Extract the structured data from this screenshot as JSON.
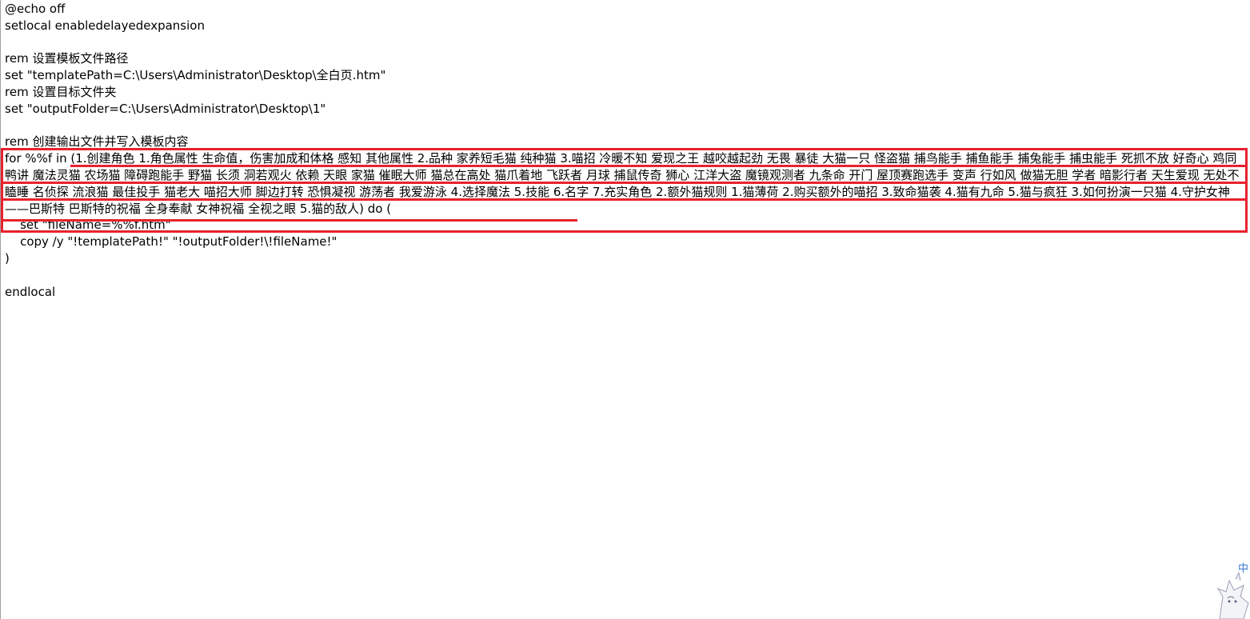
{
  "editor": {
    "lines": [
      "@echo off",
      "setlocal enabledelayedexpansion",
      "",
      "rem 设置模板文件路径",
      "set \"templatePath=C:\\Users\\Administrator\\Desktop\\全白页.htm\"",
      "rem 设置目标文件夹",
      "set \"outputFolder=C:\\Users\\Administrator\\Desktop\\1\"",
      "",
      "rem 创建输出文件并写入模板内容"
    ],
    "for_line": "for %%f in (1.创建角色 1.角色属性 生命值，伤害加成和体格 感知 其他属性 2.品种 家养短毛猫 纯种猫 3.喵招 冷暖不知 爱现之王 越咬越起劲 无畏 暴徒 大猫一只 怪盗猫 捕鸟能手 捕鱼能手 捕兔能手 捕虫能手 死抓不放 好奇心 鸡同鸭讲 魔法灵猫 农场猫 障碍跑能手 野猫 长须 洞若观火 依赖 天眼 家猫 催眠大师 猫总在高处 猫爪着地 飞跃者 月球 捕鼠传奇 狮心 江洋大盗 魔镜观测者 九条命 开门 屋顶赛跑选手 变声 行如风 做猫无胆 学者 暗影行者 天生爱现 无处不瞌睡 名侦探 流浪猫 最佳投手 猫老大 喵招大师 脚边打转 恐惧凝视 游荡者 我爱游泳 4.选择魔法 5.技能 6.名字 7.充实角色 2.额外猫规则 1.猫薄荷 2.购买额外的喵招 3.致命猫袭 4.猫有九命 5.猫与疯狂 3.如何扮演一只猫 4.守护女神——巴斯特 巴斯特的祝福 全身奉献 女神祝福 全视之眼 5.猫的敌人) do (",
    "after_lines": [
      "    set \"fileName=%%f.htm\"",
      "    copy /y \"!templatePath!\" \"!outputFolder!\\!fileName!\"",
      ")",
      "",
      "endlocal"
    ]
  },
  "ime": {
    "label": "中"
  },
  "colors": {
    "highlight_red": "#e8222e",
    "ime_blue": "#3a7bd5"
  }
}
